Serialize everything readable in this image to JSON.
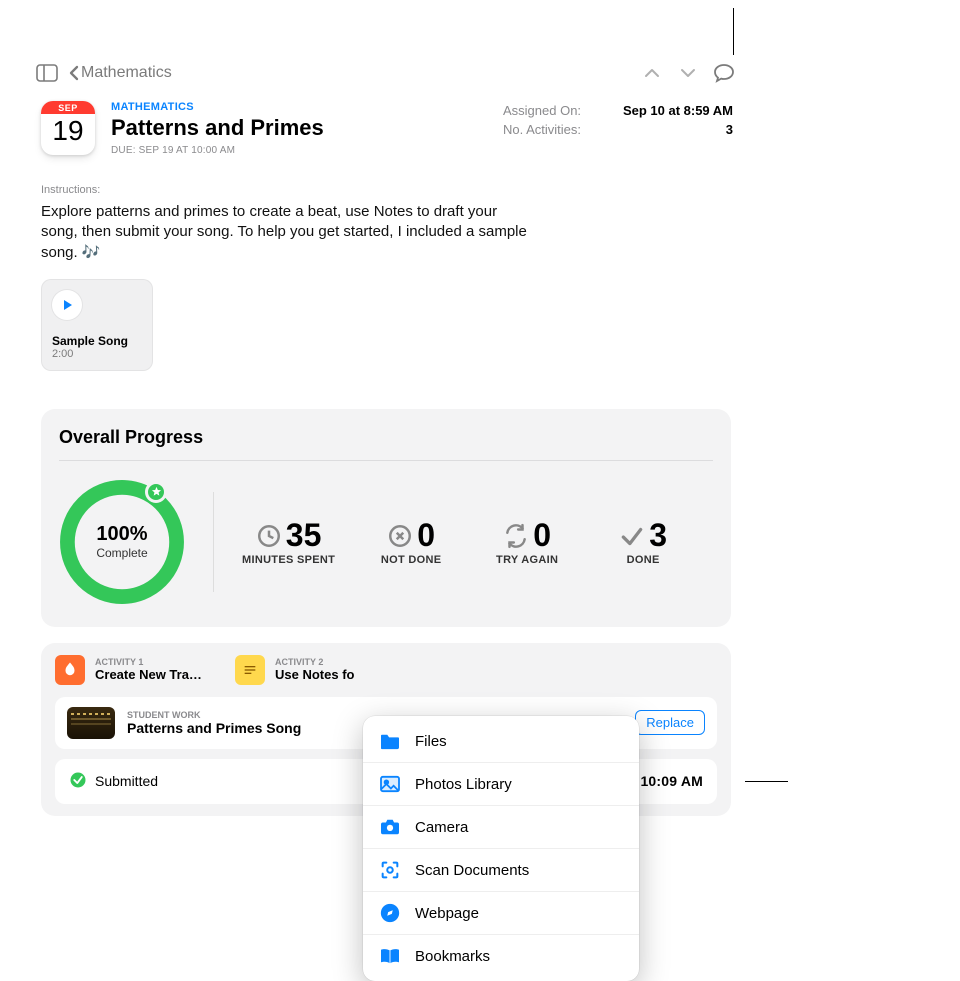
{
  "nav": {
    "back_label": "Mathematics"
  },
  "calendar": {
    "month": "SEP",
    "day": "19"
  },
  "header": {
    "subject": "MATHEMATICS",
    "title": "Patterns and Primes",
    "due": "DUE: SEP 19 AT 10:00 AM",
    "assigned_label": "Assigned On:",
    "assigned_value": "Sep 10 at 8:59 AM",
    "activities_label": "No. Activities:",
    "activities_value": "3"
  },
  "instructions": {
    "label": "Instructions:",
    "body": "Explore patterns and primes to create a beat, use Notes to draft your song, then submit your song. To help you get started, I included a sample song. 🎶"
  },
  "attachment": {
    "title": "Sample Song",
    "duration": "2:00"
  },
  "progress": {
    "title": "Overall Progress",
    "percent": "100%",
    "percent_sub": "Complete",
    "stats": {
      "minutes": {
        "value": "35",
        "label": "MINUTES SPENT"
      },
      "not_done": {
        "value": "0",
        "label": "NOT DONE"
      },
      "try_again": {
        "value": "0",
        "label": "TRY AGAIN"
      },
      "done": {
        "value": "3",
        "label": "DONE"
      }
    }
  },
  "activities": {
    "a1": {
      "num": "ACTIVITY 1",
      "name": "Create New Tra…"
    },
    "a2": {
      "num": "ACTIVITY 2",
      "name": "Use Notes fo"
    }
  },
  "student_work": {
    "label": "STUDENT WORK",
    "name": "Patterns and Primes Song",
    "replace": "Replace"
  },
  "submitted": {
    "label": "Submitted",
    "time": "10:09 AM"
  },
  "popup": {
    "items": {
      "files": "Files",
      "photos": "Photos Library",
      "camera": "Camera",
      "scan": "Scan Documents",
      "webpage": "Webpage",
      "bookmarks": "Bookmarks"
    }
  }
}
